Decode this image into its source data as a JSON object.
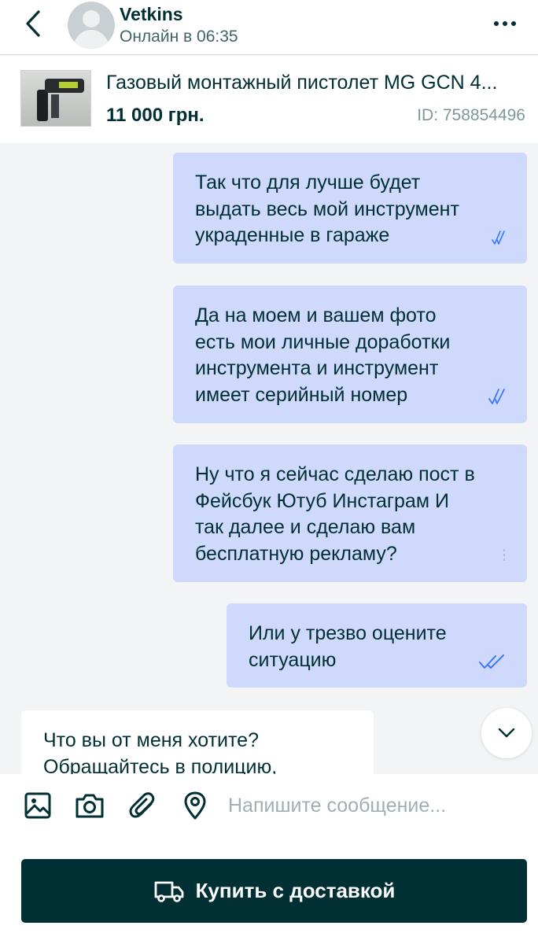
{
  "header": {
    "user_name": "Vetkins",
    "status": "Онлайн в 06:35",
    "icons": [
      "chevron-left-icon",
      "avatar-placeholder",
      "more-dots-icon"
    ]
  },
  "listing": {
    "title": "Газовый монтажный пистолет MG GCN 4...",
    "price": "11 000 грн.",
    "id": "ID: 758854496"
  },
  "messages": [
    {
      "direction": "outgoing",
      "text": "Так что для лучше будет\nвыдать весь мой инструмент\nукраденные в гараже",
      "read": true
    },
    {
      "direction": "outgoing",
      "text": "Да на моем и вашем фото\nесть мои личные доработки\nинструмента и инструмент\nимеет серийный номер",
      "read": true
    },
    {
      "direction": "outgoing",
      "text": "Ну что я сейчас сделаю пост в\nФейсбук Ютуб Инстаграм И\nтак далее и сделаю вам\nбесплатную рекламу?",
      "read": false
    },
    {
      "direction": "outgoing",
      "text": "Или у трезво оцените\nситуацию",
      "read": true
    },
    {
      "direction": "incoming",
      "text": "Что вы от меня хотите?\nОбращайтесь в полицию,"
    }
  ],
  "composer": {
    "placeholder": "Напишите сообщение...",
    "tools": [
      "image-icon",
      "camera-icon",
      "paperclip-icon",
      "location-pin-icon"
    ]
  },
  "buy_button": {
    "label": "Купить с доставкой",
    "icon": "delivery-truck-icon"
  },
  "colors": {
    "primary": "#002f34",
    "outgoing_bubble": "#ced9fc",
    "check_blue": "#3a77ff",
    "background": "#f2f4f5"
  }
}
